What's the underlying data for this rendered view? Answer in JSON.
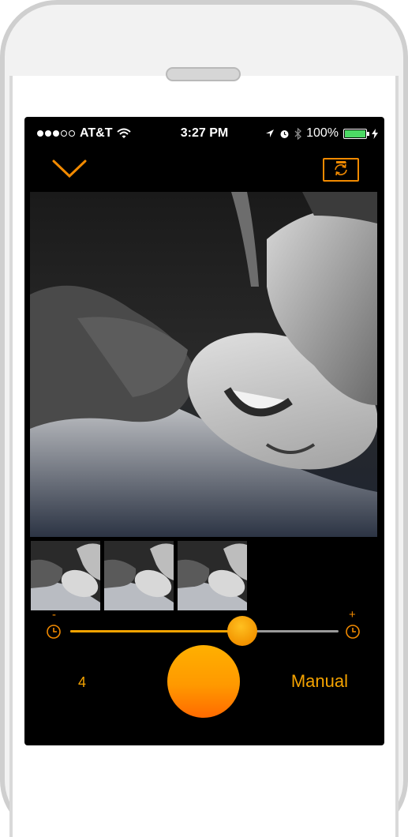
{
  "status_bar": {
    "carrier": "AT&T",
    "time": "3:27 PM",
    "battery": "100%",
    "signal_bars_filled": 3,
    "signal_bars_total": 5
  },
  "camera": {
    "close_icon": "chevron-down-icon",
    "flip_icon": "camera-flip-icon",
    "accent_color": "#f28a00"
  },
  "thumbnails": [
    {
      "icon": "photo-thumbnail"
    },
    {
      "icon": "photo-thumbnail"
    },
    {
      "icon": "photo-thumbnail"
    }
  ],
  "timer": {
    "minus": "-",
    "plus": "+",
    "slider_value": 0.64
  },
  "controls": {
    "count": "4",
    "mode": "Manual"
  }
}
